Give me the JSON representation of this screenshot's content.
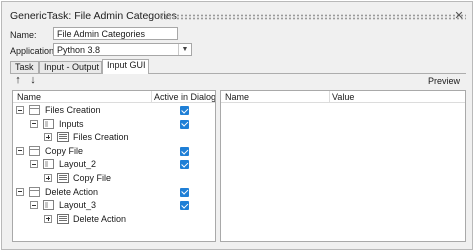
{
  "window": {
    "title": "GenericTask: File Admin Categories",
    "close_glyph": "✕"
  },
  "form": {
    "name_label": "Name:",
    "name_value": "File Admin Categories",
    "application_label": "Application:",
    "application_value": "Python 3.8"
  },
  "tabs": [
    {
      "label": "Task",
      "active": false
    },
    {
      "label": "Input - Output",
      "active": false
    },
    {
      "label": "Input GUI",
      "active": true
    }
  ],
  "toolbar": {
    "move_up_glyph": "↑",
    "move_down_glyph": "↓",
    "preview_label": "Preview"
  },
  "tree": {
    "columns": [
      "Name",
      "Active in Dialog"
    ],
    "rows": [
      {
        "label": "Files Creation",
        "depth": 0,
        "expander": "minus",
        "icon": "folder-icon",
        "active": true
      },
      {
        "label": "Inputs",
        "depth": 1,
        "expander": "minus",
        "icon": "group-icon",
        "active": true
      },
      {
        "label": "Files Creation",
        "depth": 2,
        "expander": "plus",
        "icon": "widget-icon",
        "active": false
      },
      {
        "label": "Copy File",
        "depth": 0,
        "expander": "minus",
        "icon": "folder-icon",
        "active": true
      },
      {
        "label": "Layout_2",
        "depth": 1,
        "expander": "minus",
        "icon": "group-icon",
        "active": true
      },
      {
        "label": "Copy File",
        "depth": 2,
        "expander": "plus",
        "icon": "widget-icon",
        "active": false
      },
      {
        "label": "Delete Action",
        "depth": 0,
        "expander": "minus",
        "icon": "folder-icon",
        "active": true
      },
      {
        "label": "Layout_3",
        "depth": 1,
        "expander": "minus",
        "icon": "group-icon",
        "active": true
      },
      {
        "label": "Delete Action",
        "depth": 2,
        "expander": "plus",
        "icon": "widget-icon",
        "active": false
      }
    ]
  },
  "properties": {
    "columns": [
      "Name",
      "Value"
    ]
  },
  "colors": {
    "checkbox": "#1f7fd6",
    "panel_bg": "#f0f0f0"
  }
}
